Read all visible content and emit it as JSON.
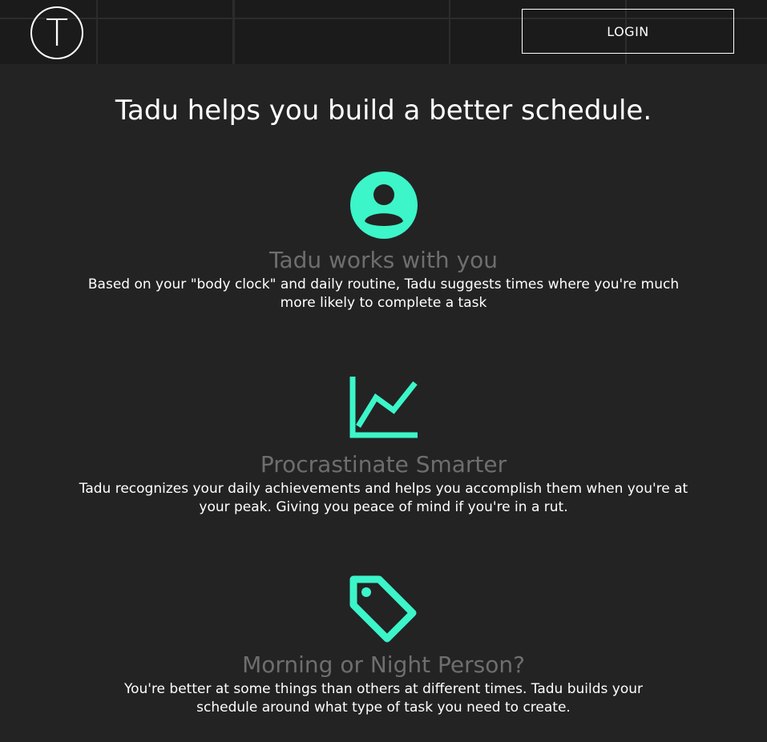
{
  "header": {
    "logo_letter": "T",
    "login_label": "LOGIN"
  },
  "main": {
    "title": "Tadu helps you build a better schedule."
  },
  "features": [
    {
      "icon": "user-circle-icon",
      "title": "Tadu works with you",
      "description": "Based on your \"body clock\" and daily routine, Tadu suggests times where you're much more likely to complete a task"
    },
    {
      "icon": "line-chart-icon",
      "title": "Procrastinate Smarter",
      "description": "Tadu recognizes your daily achievements and helps you accomplish them when you're at your peak. Giving you peace of mind if you're in a rut."
    },
    {
      "icon": "tag-icon",
      "title": "Morning or Night Person?",
      "description": "You're better at some things than others at different times. Tadu builds your schedule around what type of task you need to create."
    }
  ],
  "colors": {
    "accent": "#3cf5c9",
    "background": "#232323",
    "header_background": "#1b1b1b",
    "feature_title": "#6e6e6e",
    "text": "#ffffff"
  }
}
